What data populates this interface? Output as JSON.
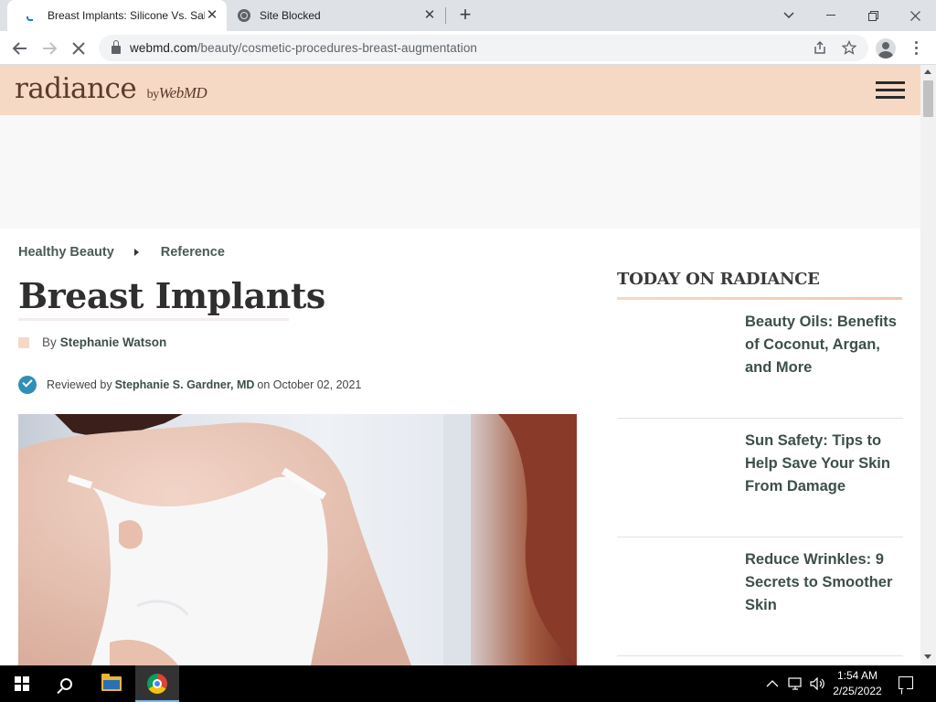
{
  "browser": {
    "tabs": [
      {
        "title": "Breast Implants: Silicone Vs. Saline",
        "active": true
      },
      {
        "title": "Site Blocked",
        "active": false
      }
    ],
    "url_domain": "webmd.com",
    "url_path": "/beauty/cosmetic-procedures-breast-augmentation"
  },
  "site": {
    "logo_main": "radiance",
    "logo_by": "by",
    "logo_brand": "WebMD",
    "header_color": "#f6d9c4"
  },
  "article": {
    "breadcrumb": [
      "Healthy Beauty",
      "Reference"
    ],
    "headline": "Breast Implants",
    "byline_prefix": "By",
    "author": "Stephanie Watson",
    "reviewed_prefix": "Reviewed by",
    "reviewer": "Stephanie S. Gardner, MD",
    "reviewed_date_text": "on October 02, 2021"
  },
  "sidebar": {
    "title": "TODAY ON RADIANCE",
    "items": [
      {
        "label": "Beauty Oils: Benefits of Coconut, Argan, and More"
      },
      {
        "label": "Sun Safety: Tips to Help Save Your Skin From Damage"
      },
      {
        "label": "Reduce Wrinkles: 9 Secrets to Smoother Skin"
      }
    ]
  },
  "taskbar": {
    "time": "1:54 AM",
    "date": "2/25/2022"
  }
}
